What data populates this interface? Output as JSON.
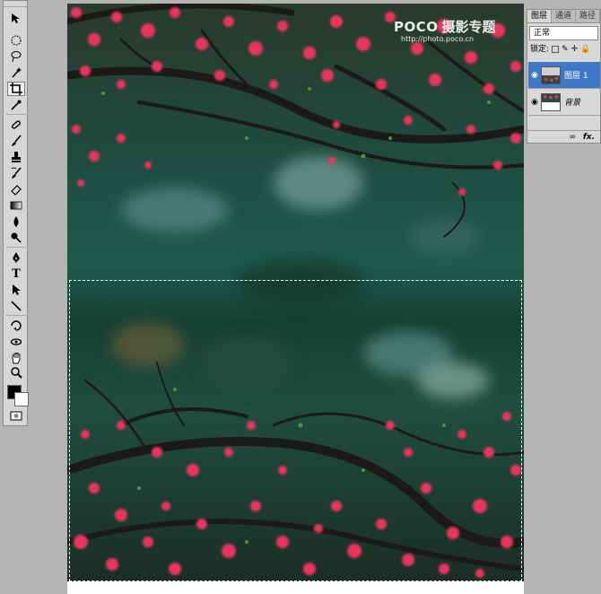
{
  "tools": [
    {
      "name": "move-tool-icon"
    },
    {
      "name": "marquee-tool-icon"
    },
    {
      "name": "lasso-tool-icon"
    },
    {
      "name": "magic-wand-tool-icon"
    },
    {
      "name": "crop-tool-icon",
      "active": true
    },
    {
      "name": "eyedropper-tool-icon"
    },
    {
      "name": "healing-brush-tool-icon"
    },
    {
      "name": "brush-tool-icon"
    },
    {
      "name": "clone-stamp-tool-icon"
    },
    {
      "name": "history-brush-tool-icon"
    },
    {
      "name": "eraser-tool-icon"
    },
    {
      "name": "gradient-tool-icon"
    },
    {
      "name": "blur-tool-icon"
    },
    {
      "name": "dodge-tool-icon"
    },
    {
      "name": "pen-tool-icon"
    },
    {
      "name": "type-tool-icon",
      "glyph": "T"
    },
    {
      "name": "path-selection-tool-icon"
    },
    {
      "name": "line-tool-icon"
    },
    {
      "name": "3d-rotate-tool-icon"
    },
    {
      "name": "3d-orbit-tool-icon"
    },
    {
      "name": "hand-tool-icon"
    },
    {
      "name": "zoom-tool-icon"
    }
  ],
  "colors": {
    "foreground": "#000000",
    "background": "#ffffff",
    "selected_layer": "#3e78c8"
  },
  "watermark": {
    "brand": "POCO",
    "subtitle": "摄影专题",
    "url": "http://photo.poco.cn"
  },
  "layers_panel": {
    "tabs": [
      "图层",
      "通道",
      "路径"
    ],
    "blend_mode": "正常",
    "lock_label": "锁定:",
    "layers": [
      {
        "name": "图层 1",
        "selected": true,
        "visible": true
      },
      {
        "name": "背景",
        "selected": false,
        "visible": true
      }
    ],
    "footer_icons": [
      "link-icon",
      "fx-icon"
    ],
    "fx_label": "fx."
  }
}
